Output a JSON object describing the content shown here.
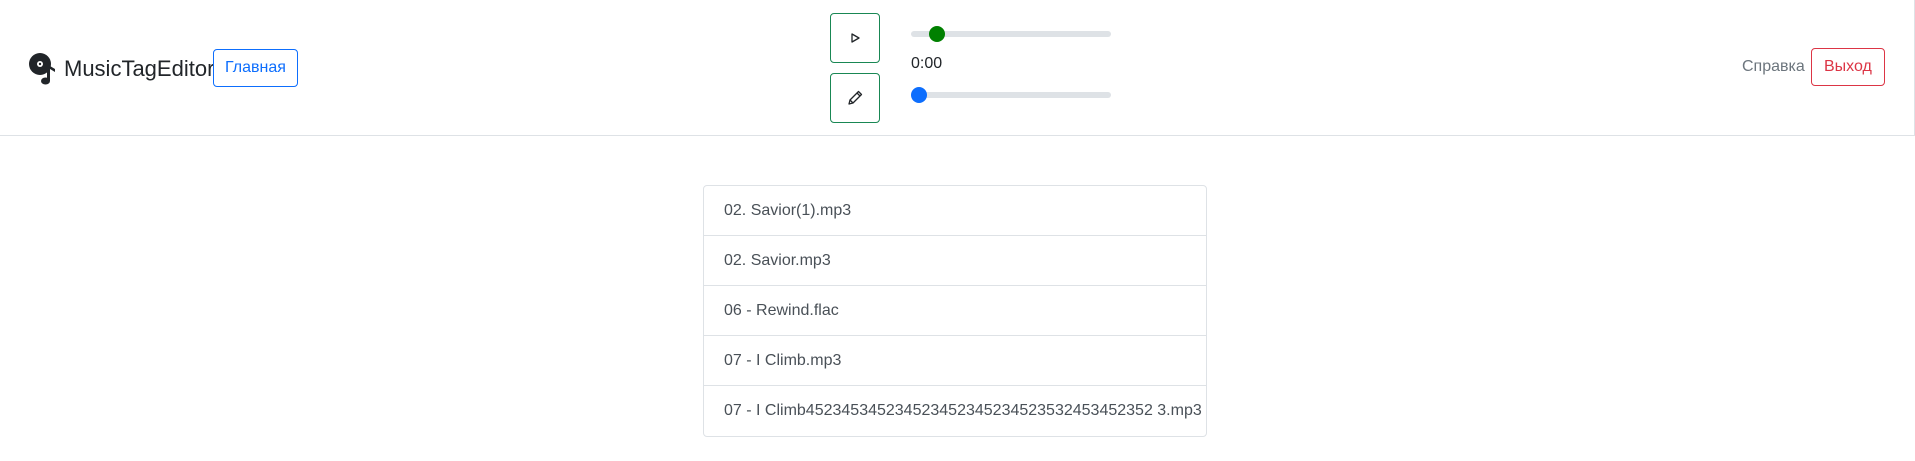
{
  "navbar": {
    "brand": "MusicTagEditor",
    "home_button": "Главная",
    "help_link": "Справка",
    "exit_button": "Выход"
  },
  "player": {
    "time": "0:00",
    "volume_level": 0.1,
    "progress": 0.0,
    "colors": {
      "volume_thumb": "#008000",
      "progress_thumb": "#0d6efd",
      "control_border": "#198754"
    },
    "icons": {
      "play": "play-icon",
      "edit": "pencil-icon"
    }
  },
  "files": [
    "02. Savior(1).mp3",
    "02. Savior.mp3",
    "06 - Rewind.flac",
    "07 - I Climb.mp3",
    "07 - I Climb452345345234523452345234523532453452352 3.mp3"
  ]
}
